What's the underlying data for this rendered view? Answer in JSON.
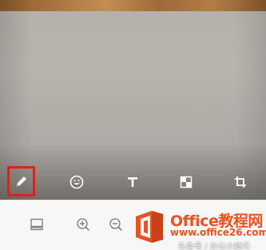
{
  "photo": {
    "description_colors": {
      "wall": "#b5b1ab",
      "wood_trim": "#a8743f"
    }
  },
  "edit_toolbar": {
    "tools": [
      {
        "name": "pencil",
        "icon": "pencil-icon",
        "selected": true
      },
      {
        "name": "emoji",
        "icon": "smiley-icon",
        "selected": false
      },
      {
        "name": "text",
        "icon": "text-T-icon",
        "selected": false
      },
      {
        "name": "mosaic",
        "icon": "mosaic-icon",
        "selected": false
      },
      {
        "name": "crop",
        "icon": "crop-icon",
        "selected": false
      }
    ],
    "selected_highlight_color": "#e0211b"
  },
  "bottom_bar": {
    "tools": [
      {
        "name": "panel",
        "icon": "panel-icon"
      },
      {
        "name": "zoom-in",
        "icon": "zoom-in-icon"
      },
      {
        "name": "zoom-out",
        "icon": "zoom-out-icon"
      }
    ]
  },
  "watermark": {
    "brand": "Office教程网",
    "url": "www.office26.com",
    "caption": "头条号 / 办公小技巧",
    "brand_color": "#e8531f"
  }
}
